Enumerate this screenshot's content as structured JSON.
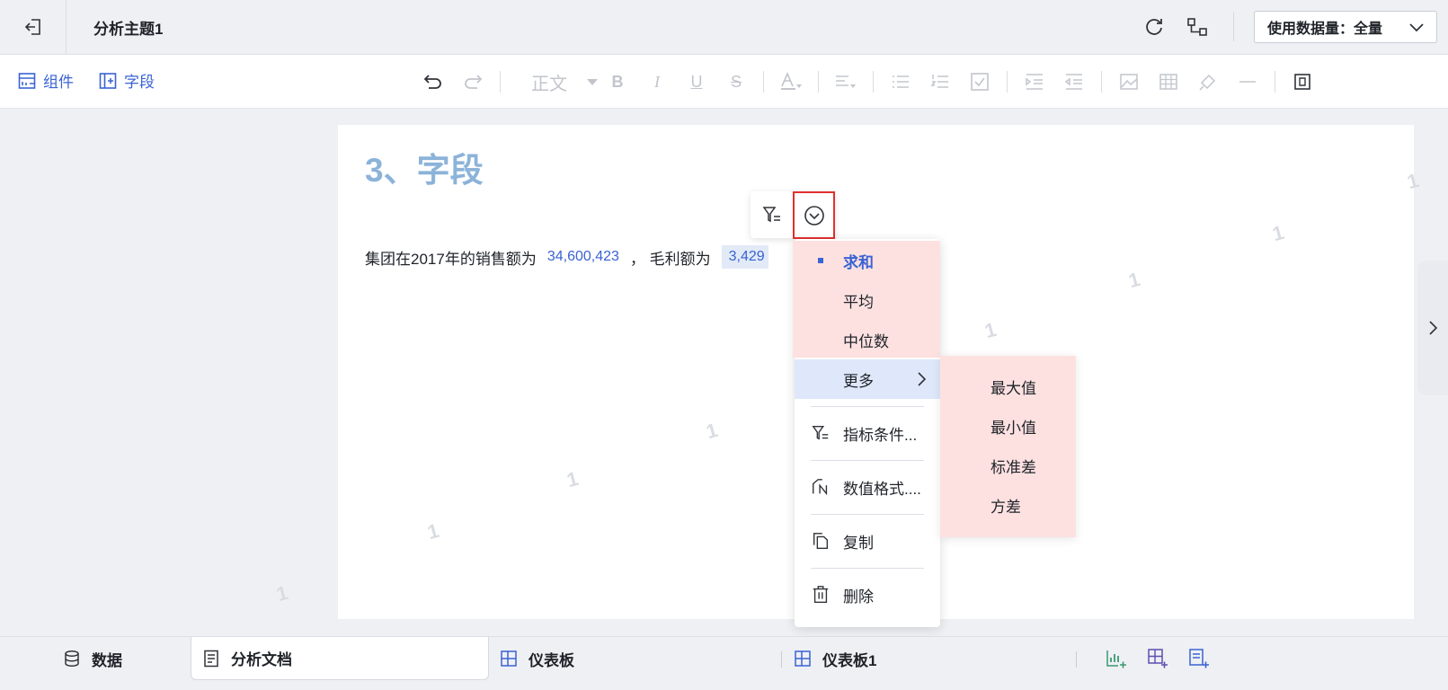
{
  "header": {
    "title": "分析主题1",
    "data_volume_label": "使用数据量：全量"
  },
  "toolbar": {
    "components_label": "组件",
    "fields_label": "字段",
    "paragraph_style": "正文"
  },
  "document": {
    "heading": "3、字段",
    "sentence_prefix": "集团在2017年的销售额为",
    "sales_value": "34,600,423",
    "sentence_mid": "，  毛利额为",
    "gross_profit_value_visible": "3,429"
  },
  "watermark_glyph": "1",
  "context_menu": {
    "aggregations": [
      {
        "label": "求和",
        "selected": true
      },
      {
        "label": "平均",
        "selected": false
      },
      {
        "label": "中位数",
        "selected": false
      }
    ],
    "more_label": "更多",
    "condition_label": "指标条件...",
    "format_label": "数值格式....",
    "copy_label": "复制",
    "delete_label": "删除"
  },
  "submenu": {
    "items": [
      "最大值",
      "最小值",
      "标准差",
      "方差"
    ]
  },
  "tabs": [
    {
      "label": "数据",
      "active": false
    },
    {
      "label": "分析文档",
      "active": true
    },
    {
      "label": "仪表板",
      "active": false
    },
    {
      "label": "仪表板1",
      "active": false
    }
  ],
  "colors": {
    "accent": "#3a63d3",
    "heading": "#8cb3d9",
    "highlight_red": "#e0302d",
    "menu_group_bg": "#fde1e1"
  }
}
